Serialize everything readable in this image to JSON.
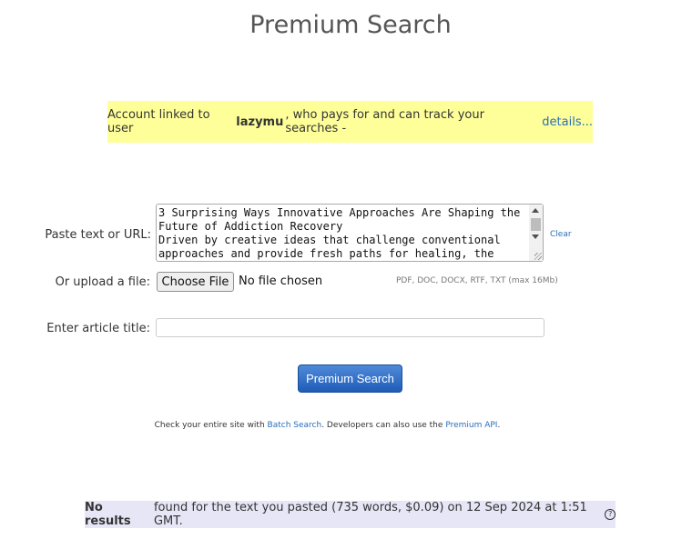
{
  "page": {
    "title": "Premium Search"
  },
  "notice": {
    "prefix": "Account linked to user",
    "username": "lazymu",
    "suffix": ", who pays for and can track your searches -",
    "details_link": "details..."
  },
  "form": {
    "text_label": "Paste text or URL:",
    "text_value": "3 Surprising Ways Innovative Approaches Are Shaping the Future of Addiction Recovery\nDriven by creative ideas that challenge conventional approaches and provide fresh paths for healing, the",
    "clear_link": "Clear",
    "file_label": "Or upload a file:",
    "file_button": "Choose File",
    "file_status": "No file chosen",
    "file_hint": "PDF, DOC, DOCX, RTF, TXT (max 16Mb)",
    "article_title_label": "Enter article title:",
    "article_title_value": "",
    "submit_label": "Premium Search"
  },
  "tip": {
    "text1": "Check your entire site with",
    "batch_link": "Batch Search",
    "text2": ". Developers can also use the",
    "api_link": "Premium API",
    "text3": "."
  },
  "results": {
    "bold": "No results",
    "text": "found for the text you pasted (735 words, $0.09) on 12 Sep 2024 at 1:51 GMT.",
    "help_glyph": "?"
  },
  "icons": {
    "help": "question-circle-icon",
    "scroll_up": "arrow-up-icon",
    "scroll_down": "arrow-down-icon"
  },
  "colors": {
    "notice_bg": "#ffff99",
    "link": "#2a6ebb",
    "button": "#1f5cb8",
    "results_bg": "#e6e6f7"
  }
}
